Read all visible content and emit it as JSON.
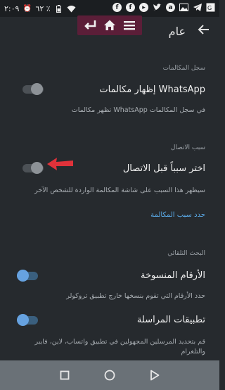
{
  "status_bar": {
    "time": "٢:٠٩",
    "battery": "٦٢ ٪"
  },
  "app_bar": {
    "title": "عام"
  },
  "sections": [
    {
      "header": "سجل المكالمات",
      "settings": [
        {
          "title": "إظهار مكالمات WhatsApp",
          "subtitle": "تظهر مكالمات WhatsApp في سجل المكالمات",
          "enabled": false
        }
      ]
    },
    {
      "header": "سبب الاتصال",
      "settings": [
        {
          "title": "اختر سبباً قبل الاتصال",
          "subtitle": "سيظهر هذا السبب على شاشة المكالمة الواردة للشخص الآخر",
          "enabled": false
        }
      ],
      "link": "حدد سبب المكالمة"
    },
    {
      "header": "البحث التلقائي",
      "settings": [
        {
          "title": "الأرقام المنسوخة",
          "subtitle": "حدد الأرقام التي تقوم بنسخها خارج تطبيق تروكولر",
          "enabled": true
        },
        {
          "title": "تطبيقات المراسلة",
          "subtitle": "قم بتحديد المرسلين المجهولين في تطبيق واتساب، لاين، فايبر والتلغرام",
          "enabled": true
        }
      ]
    }
  ],
  "colors": {
    "background": "#262a2e",
    "link": "#5aa9e6",
    "toggle_on": "#66a2e0",
    "overlay_toolbar": "#5b1e38",
    "annotation_arrow": "#e0323a"
  }
}
